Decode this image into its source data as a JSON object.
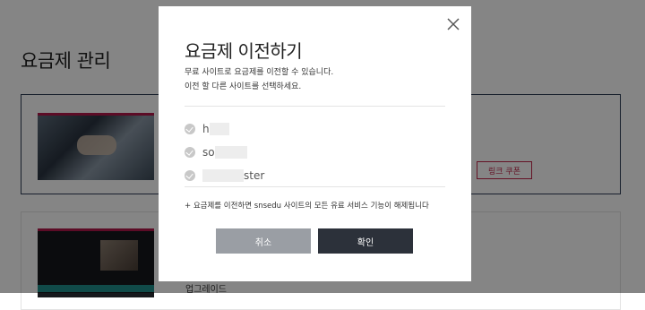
{
  "background": {
    "page_title": "요금제 관리",
    "card1_button": "링크 쿠폰",
    "card2_text": "업그레이드"
  },
  "modal": {
    "title": "요금제 이전하기",
    "desc_line1": "무료 사이트로 요금제를 이전할 수 있습니다.",
    "desc_line2": "이전 할 다른 사이트를 선택하세요.",
    "sites": [
      {
        "label": "h"
      },
      {
        "label": "so"
      },
      {
        "label": "ster"
      }
    ],
    "notice": "+ 요금제를 이전하면 snsedu 사이트의 모든 유료 서비스 기능이 해제됩니다",
    "cancel_label": "취소",
    "confirm_label": "확인"
  },
  "colors": {
    "accent": "#c0264a",
    "confirm_bg": "#2c313a",
    "cancel_bg": "#9a9ea4"
  },
  "icons": {
    "close": "close-icon",
    "check": "check-circle-icon"
  }
}
